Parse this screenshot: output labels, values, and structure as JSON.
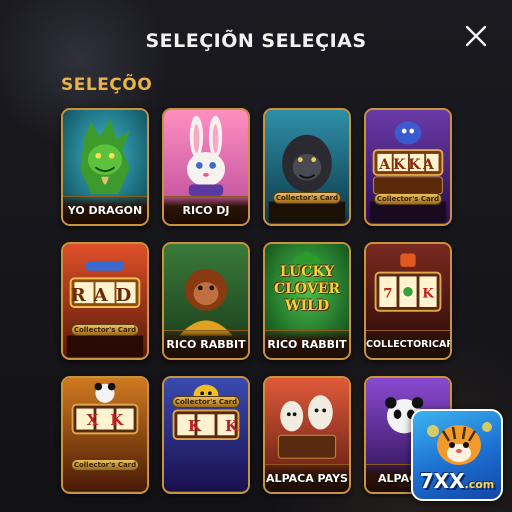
{
  "header": {
    "title": "SELEÇIÕN SELEÇIAS",
    "close_icon": "close-icon"
  },
  "section": {
    "label": "SELEÇÕO"
  },
  "games": [
    {
      "name": "YO DRAGON",
      "badge": ""
    },
    {
      "name": "RICO DJ",
      "badge": ""
    },
    {
      "name": "",
      "badge": "Collector's Card"
    },
    {
      "name": "",
      "badge": "Collector's Card",
      "reel": "AKKA"
    },
    {
      "name": "",
      "badge": "Collector's Card",
      "reel": "RAD"
    },
    {
      "name": "RICO RABBIT",
      "badge": ""
    },
    {
      "name": "RICO RABBIT",
      "badge": "",
      "art_text": [
        "LUCKY",
        "CLOVER",
        "WILD"
      ]
    },
    {
      "name": "COLLECTORICARD",
      "badge": ""
    },
    {
      "name": "",
      "badge": "Collector's Card",
      "reel": "XK"
    },
    {
      "name": "",
      "badge": "Collector's Card",
      "reel": "KK"
    },
    {
      "name": "ALPACA PAYS",
      "badge": ""
    },
    {
      "name": "ALPACA",
      "badge": ""
    }
  ],
  "logo": {
    "brand": "7XX",
    "suffix": ".com"
  },
  "colors": {
    "accent_gold": "#e9b34a",
    "card_border": "#c9923c",
    "background": "#141418",
    "logo_blue": "#1d6fd0"
  }
}
